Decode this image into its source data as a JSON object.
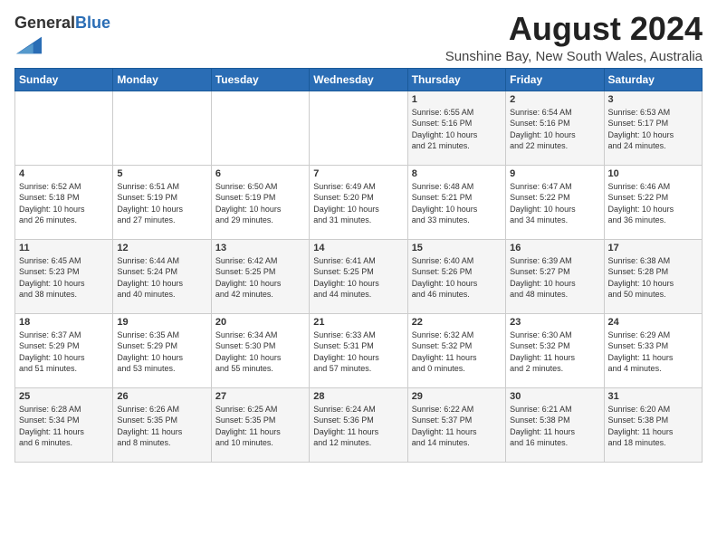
{
  "header": {
    "logo_general": "General",
    "logo_blue": "Blue",
    "month_year": "August 2024",
    "location": "Sunshine Bay, New South Wales, Australia"
  },
  "weekdays": [
    "Sunday",
    "Monday",
    "Tuesday",
    "Wednesday",
    "Thursday",
    "Friday",
    "Saturday"
  ],
  "weeks": [
    [
      {
        "day": "",
        "info": ""
      },
      {
        "day": "",
        "info": ""
      },
      {
        "day": "",
        "info": ""
      },
      {
        "day": "",
        "info": ""
      },
      {
        "day": "1",
        "info": "Sunrise: 6:55 AM\nSunset: 5:16 PM\nDaylight: 10 hours\nand 21 minutes."
      },
      {
        "day": "2",
        "info": "Sunrise: 6:54 AM\nSunset: 5:16 PM\nDaylight: 10 hours\nand 22 minutes."
      },
      {
        "day": "3",
        "info": "Sunrise: 6:53 AM\nSunset: 5:17 PM\nDaylight: 10 hours\nand 24 minutes."
      }
    ],
    [
      {
        "day": "4",
        "info": "Sunrise: 6:52 AM\nSunset: 5:18 PM\nDaylight: 10 hours\nand 26 minutes."
      },
      {
        "day": "5",
        "info": "Sunrise: 6:51 AM\nSunset: 5:19 PM\nDaylight: 10 hours\nand 27 minutes."
      },
      {
        "day": "6",
        "info": "Sunrise: 6:50 AM\nSunset: 5:19 PM\nDaylight: 10 hours\nand 29 minutes."
      },
      {
        "day": "7",
        "info": "Sunrise: 6:49 AM\nSunset: 5:20 PM\nDaylight: 10 hours\nand 31 minutes."
      },
      {
        "day": "8",
        "info": "Sunrise: 6:48 AM\nSunset: 5:21 PM\nDaylight: 10 hours\nand 33 minutes."
      },
      {
        "day": "9",
        "info": "Sunrise: 6:47 AM\nSunset: 5:22 PM\nDaylight: 10 hours\nand 34 minutes."
      },
      {
        "day": "10",
        "info": "Sunrise: 6:46 AM\nSunset: 5:22 PM\nDaylight: 10 hours\nand 36 minutes."
      }
    ],
    [
      {
        "day": "11",
        "info": "Sunrise: 6:45 AM\nSunset: 5:23 PM\nDaylight: 10 hours\nand 38 minutes."
      },
      {
        "day": "12",
        "info": "Sunrise: 6:44 AM\nSunset: 5:24 PM\nDaylight: 10 hours\nand 40 minutes."
      },
      {
        "day": "13",
        "info": "Sunrise: 6:42 AM\nSunset: 5:25 PM\nDaylight: 10 hours\nand 42 minutes."
      },
      {
        "day": "14",
        "info": "Sunrise: 6:41 AM\nSunset: 5:25 PM\nDaylight: 10 hours\nand 44 minutes."
      },
      {
        "day": "15",
        "info": "Sunrise: 6:40 AM\nSunset: 5:26 PM\nDaylight: 10 hours\nand 46 minutes."
      },
      {
        "day": "16",
        "info": "Sunrise: 6:39 AM\nSunset: 5:27 PM\nDaylight: 10 hours\nand 48 minutes."
      },
      {
        "day": "17",
        "info": "Sunrise: 6:38 AM\nSunset: 5:28 PM\nDaylight: 10 hours\nand 50 minutes."
      }
    ],
    [
      {
        "day": "18",
        "info": "Sunrise: 6:37 AM\nSunset: 5:29 PM\nDaylight: 10 hours\nand 51 minutes."
      },
      {
        "day": "19",
        "info": "Sunrise: 6:35 AM\nSunset: 5:29 PM\nDaylight: 10 hours\nand 53 minutes."
      },
      {
        "day": "20",
        "info": "Sunrise: 6:34 AM\nSunset: 5:30 PM\nDaylight: 10 hours\nand 55 minutes."
      },
      {
        "day": "21",
        "info": "Sunrise: 6:33 AM\nSunset: 5:31 PM\nDaylight: 10 hours\nand 57 minutes."
      },
      {
        "day": "22",
        "info": "Sunrise: 6:32 AM\nSunset: 5:32 PM\nDaylight: 11 hours\nand 0 minutes."
      },
      {
        "day": "23",
        "info": "Sunrise: 6:30 AM\nSunset: 5:32 PM\nDaylight: 11 hours\nand 2 minutes."
      },
      {
        "day": "24",
        "info": "Sunrise: 6:29 AM\nSunset: 5:33 PM\nDaylight: 11 hours\nand 4 minutes."
      }
    ],
    [
      {
        "day": "25",
        "info": "Sunrise: 6:28 AM\nSunset: 5:34 PM\nDaylight: 11 hours\nand 6 minutes."
      },
      {
        "day": "26",
        "info": "Sunrise: 6:26 AM\nSunset: 5:35 PM\nDaylight: 11 hours\nand 8 minutes."
      },
      {
        "day": "27",
        "info": "Sunrise: 6:25 AM\nSunset: 5:35 PM\nDaylight: 11 hours\nand 10 minutes."
      },
      {
        "day": "28",
        "info": "Sunrise: 6:24 AM\nSunset: 5:36 PM\nDaylight: 11 hours\nand 12 minutes."
      },
      {
        "day": "29",
        "info": "Sunrise: 6:22 AM\nSunset: 5:37 PM\nDaylight: 11 hours\nand 14 minutes."
      },
      {
        "day": "30",
        "info": "Sunrise: 6:21 AM\nSunset: 5:38 PM\nDaylight: 11 hours\nand 16 minutes."
      },
      {
        "day": "31",
        "info": "Sunrise: 6:20 AM\nSunset: 5:38 PM\nDaylight: 11 hours\nand 18 minutes."
      }
    ]
  ]
}
